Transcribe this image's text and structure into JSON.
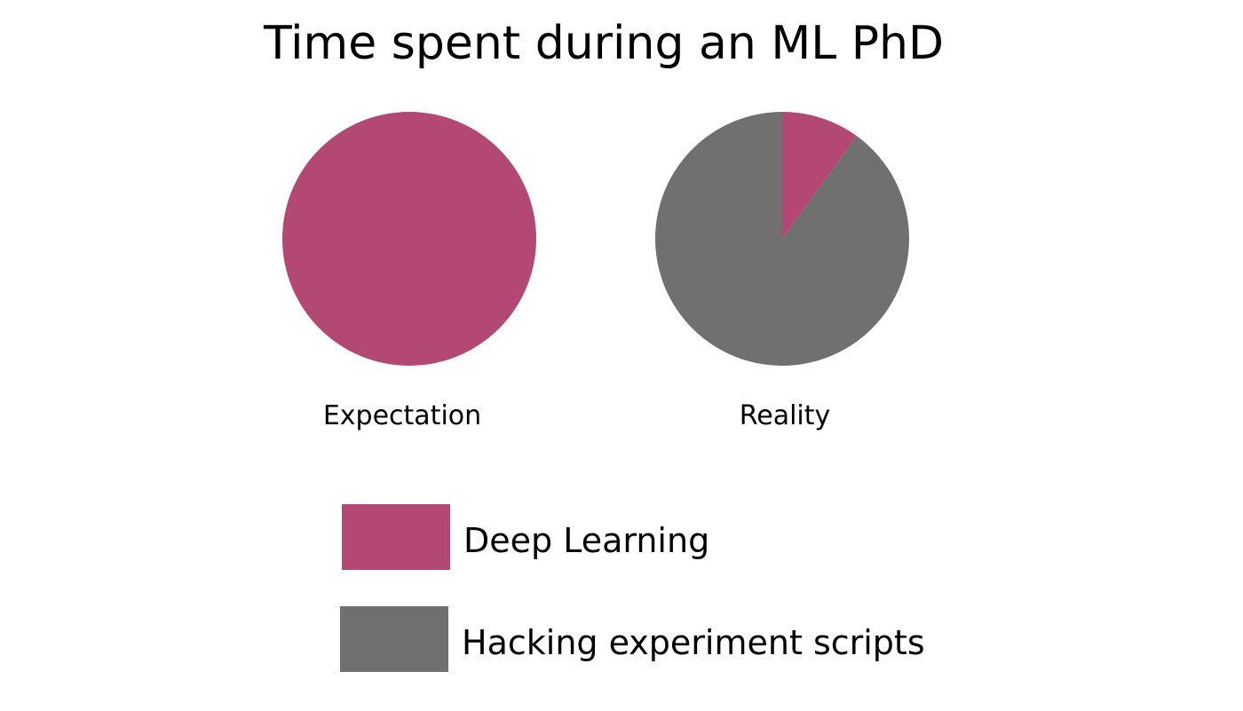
{
  "chart_data": {
    "type": "pie",
    "title": "Time spent during an ML PhD",
    "categories": [
      "Deep Learning",
      "Hacking experiment scripts"
    ],
    "colors": [
      "#b24873",
      "#707071"
    ],
    "legend_placement": "bottom-center",
    "pies": [
      {
        "label": "Expectation",
        "values": [
          100,
          0
        ]
      },
      {
        "label": "Reality",
        "values": [
          10,
          90
        ]
      }
    ]
  }
}
